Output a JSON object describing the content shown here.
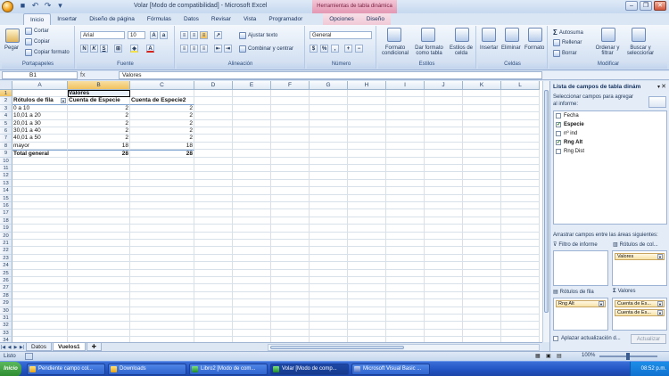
{
  "window": {
    "title": "Volar  [Modo de compatibilidad] - Microsoft Excel",
    "context_title": "Herramientas de tabla dinámica"
  },
  "tabs": [
    "Inicio",
    "Insertar",
    "Diseño de página",
    "Fórmulas",
    "Datos",
    "Revisar",
    "Vista",
    "Programador",
    "Opciones",
    "Diseño"
  ],
  "ribbon": {
    "clipboard": {
      "paste": "Pegar",
      "cut": "Cortar",
      "copy": "Copiar",
      "format_painter": "Copiar formato",
      "label": "Portapapeles"
    },
    "font": {
      "name": "Arial",
      "size": "10",
      "label": "Fuente"
    },
    "alignment": {
      "wrap": "Ajustar texto",
      "merge": "Combinar y centrar",
      "label": "Alineación"
    },
    "number": {
      "format": "General",
      "label": "Número"
    },
    "styles": {
      "cond": "Formato condicional",
      "table": "Dar formato como tabla",
      "cell": "Estilos de celda",
      "label": "Estilos"
    },
    "cells": {
      "insert": "Insertar",
      "delete": "Eliminar",
      "format": "Formato",
      "label": "Celdas"
    },
    "editing": {
      "autosum": "Autosuma",
      "fill": "Rellenar",
      "clear": "Borrar",
      "sort": "Ordenar y filtrar",
      "find": "Buscar y seleccionar",
      "label": "Modificar"
    }
  },
  "formula_bar": {
    "name_box": "B1",
    "fx": "fx",
    "value": "Valores"
  },
  "columns": [
    "A",
    "B",
    "C",
    "D",
    "E",
    "F",
    "G",
    "H",
    "I",
    "J",
    "K",
    "L"
  ],
  "rows": [
    [
      "",
      "Valores",
      ""
    ],
    [
      "Rótulos de fila",
      "Cuenta de Especie",
      "Cuenta de Especie2"
    ],
    [
      "0 a 10",
      "2",
      "2"
    ],
    [
      "10,01  a 20",
      "2",
      "2"
    ],
    [
      "20,01 a 30",
      "2",
      "2"
    ],
    [
      "30,01 a 40",
      "2",
      "2"
    ],
    [
      "40,01 a 50",
      "2",
      "2"
    ],
    [
      "mayor",
      "18",
      "18"
    ],
    [
      "Total general",
      "28",
      "28"
    ]
  ],
  "row_count": 34,
  "sheets": [
    "Datos",
    "Vuelos1"
  ],
  "panel": {
    "title": "Lista de campos de tabla dinám",
    "desc": "Seleccionar campos para agregar al informe:",
    "fields": [
      {
        "name": "Fecha",
        "checked": false
      },
      {
        "name": "Especie",
        "checked": true
      },
      {
        "name": "nº ind",
        "checked": false
      },
      {
        "name": "Rng Alt",
        "checked": true
      },
      {
        "name": "Rng Dist",
        "checked": false
      }
    ],
    "drag_text": "Arrastrar campos entre las áreas siguientes:",
    "filter_label": "Filtro de informe",
    "col_label": "Rótulos de col...",
    "row_label": "Rótulos de fila",
    "values_label": "Valores",
    "col_items": [
      "Valores"
    ],
    "row_items": [
      "Rng Alt"
    ],
    "value_items": [
      "Cuenta de Es...",
      "Cuenta de Es..."
    ],
    "defer": "Aplazar actualización d...",
    "update": "Actualizar"
  },
  "status": {
    "text": "Listo",
    "zoom": "100%"
  },
  "taskbar": {
    "start": "Inicio",
    "items": [
      "Pendiente campo col...",
      "Downloads",
      "Libro2  [Modo de com...",
      "Volar  [Modo de comp...",
      "Microsoft Visual Basic ..."
    ],
    "clock": "08:52 p.m."
  }
}
